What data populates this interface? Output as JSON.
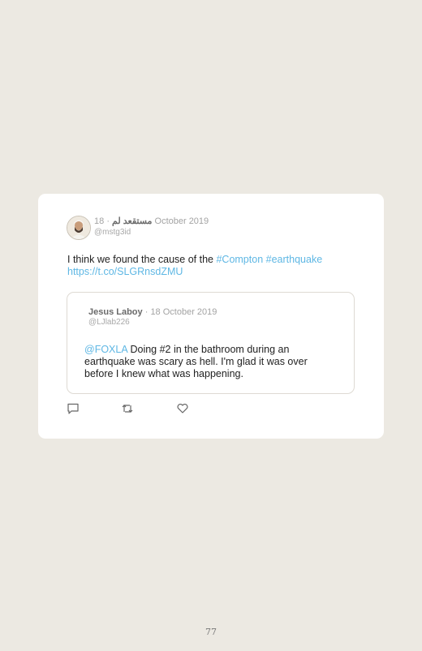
{
  "tweet": {
    "author_name": "مستقعد لم",
    "separator": "·",
    "date": "18 October 2019",
    "handle": "@mstg3id",
    "text_plain": "I think we found the cause of the ",
    "hashtag1": "#Compton",
    "hashtag2": "#earthquake",
    "link": "https://t.co/SLGRnsdZMU"
  },
  "quoted": {
    "author_name": "Jesus Laboy",
    "separator": "·",
    "date": "18 October 2019",
    "handle": "@LJlab226",
    "mention": "@FOXLA",
    "text": " Doing #2 in the bathroom during an earthquake was scary as hell. I'm glad it was over before I knew what was happening."
  },
  "actions": [
    "reply-icon",
    "retweet-icon",
    "like-icon"
  ],
  "colors": {
    "link": "#5eb7e4",
    "background": "#ece9e2",
    "card": "#ffffff"
  },
  "page_number": "77"
}
